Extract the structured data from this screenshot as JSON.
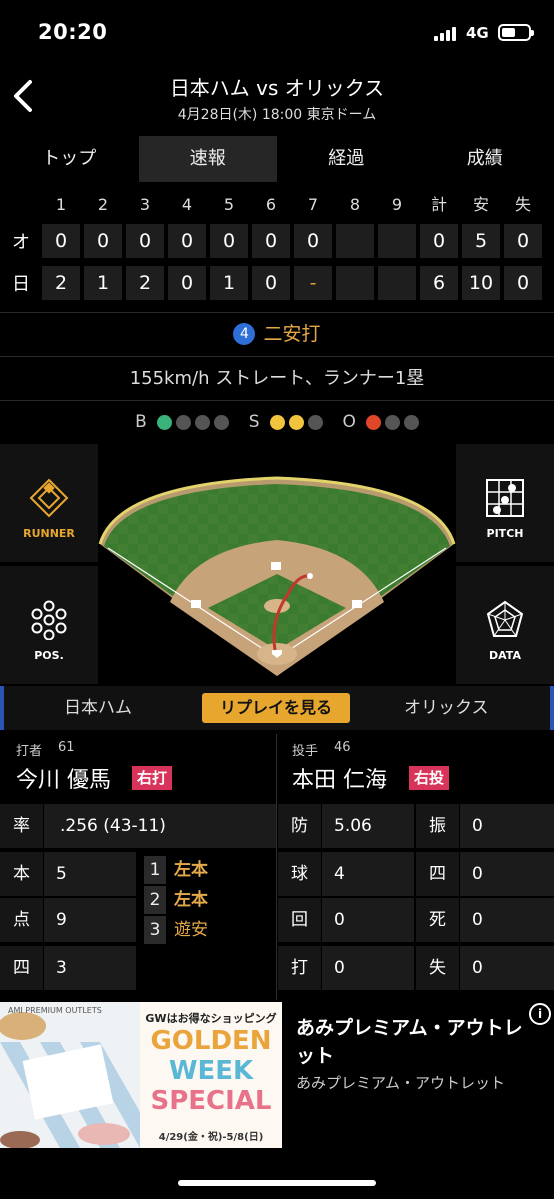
{
  "status": {
    "time": "20:20",
    "network": "4G"
  },
  "header": {
    "title": "日本ハム vs オリックス",
    "subtitle": "4月28日(木) 18:00 東京ドーム"
  },
  "tabs": [
    {
      "label": "トップ",
      "active": false
    },
    {
      "label": "速報",
      "active": true
    },
    {
      "label": "経過",
      "active": false
    },
    {
      "label": "成績",
      "active": false
    }
  ],
  "scoreboard": {
    "headers": [
      "1",
      "2",
      "3",
      "4",
      "5",
      "6",
      "7",
      "8",
      "9",
      "計",
      "安",
      "失"
    ],
    "rows": [
      {
        "team": "オ",
        "innings": [
          "0",
          "0",
          "0",
          "0",
          "0",
          "0",
          "0",
          "",
          ""
        ],
        "totals": [
          "0",
          "5",
          "0"
        ]
      },
      {
        "team": "日",
        "innings": [
          "2",
          "1",
          "2",
          "0",
          "1",
          "0",
          "-",
          "",
          ""
        ],
        "totals": [
          "6",
          "10",
          "0"
        ]
      }
    ]
  },
  "play": {
    "number": "4",
    "result": "二安打",
    "pitch_desc": "155km/h ストレート、ランナー1塁"
  },
  "count": {
    "b_label": "B",
    "s_label": "S",
    "o_label": "O",
    "balls": 1,
    "strikes": 2,
    "outs": 1
  },
  "field_buttons": {
    "runner": "RUNNER",
    "pos": "POS.",
    "pitch": "PITCH",
    "data": "DATA"
  },
  "replay": {
    "home_team": "日本ハム",
    "away_team": "オリックス",
    "button": "リプレイを見る"
  },
  "batter": {
    "role": "打者",
    "number": "61",
    "name": "今川 優馬",
    "hand": "右打",
    "stats": [
      {
        "k": "率",
        "v": ".256 (43-11)"
      },
      {
        "k": "本",
        "v": "5"
      },
      {
        "k": "点",
        "v": "9"
      },
      {
        "k": "四",
        "v": "3"
      }
    ],
    "history": [
      {
        "n": "1",
        "r": "左本"
      },
      {
        "n": "2",
        "r": "左本"
      },
      {
        "n": "3",
        "r": "遊安"
      }
    ]
  },
  "pitcher": {
    "role": "投手",
    "number": "46",
    "name": "本田 仁海",
    "hand": "右投",
    "stats_left": [
      {
        "k": "防",
        "v": "5.06"
      },
      {
        "k": "球",
        "v": "4"
      },
      {
        "k": "回",
        "v": "0"
      },
      {
        "k": "打",
        "v": "0"
      }
    ],
    "stats_right": [
      {
        "k": "振",
        "v": "0"
      },
      {
        "k": "四",
        "v": "0"
      },
      {
        "k": "死",
        "v": "0"
      },
      {
        "k": "失",
        "v": "0"
      }
    ]
  },
  "ad": {
    "brand_small": "AMI PREMIUM OUTLETS",
    "promo_top": "GWはお得なショッピング",
    "promo_lines": [
      "GOLDEN",
      "WEEK",
      "SPECIAL"
    ],
    "promo_dates": "4/29(金・祝)-5/8(日)",
    "title": "あみプレミアム・アウトレット",
    "advertiser": "あみプレミアム・アウトレット",
    "info": "i"
  },
  "colors": {
    "accent": "#e7a72f",
    "badge": "#d8335b",
    "ball": "#39b27b",
    "strike": "#f2c33c",
    "out": "#e04628"
  }
}
